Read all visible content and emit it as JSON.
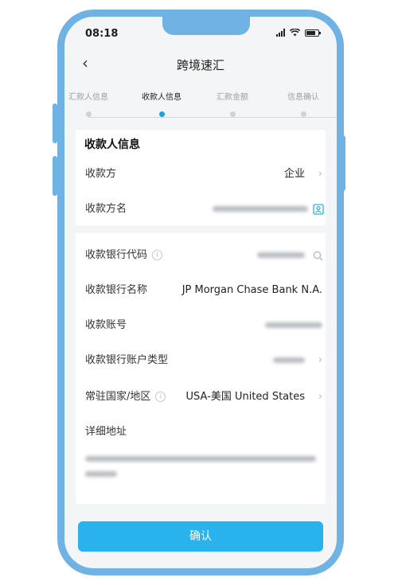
{
  "status_bar": {
    "time": "08:18"
  },
  "header": {
    "title": "跨境速汇"
  },
  "steps": [
    {
      "label": "汇款人信息",
      "active": false
    },
    {
      "label": "收款人信息",
      "active": true
    },
    {
      "label": "汇款金额",
      "active": false
    },
    {
      "label": "信息确认",
      "active": false
    }
  ],
  "section_title": "收款人信息",
  "payee": {
    "type_label": "收款方",
    "type_value": "企业",
    "name_label": "收款方名"
  },
  "bank": {
    "code_label": "收款银行代码",
    "name_label": "收款银行名称",
    "name_value": "JP Morgan Chase Bank N.A.",
    "account_label": "收款账号",
    "account_type_label": "收款银行账户类型",
    "country_label": "常驻国家/地区",
    "country_value": "USA-美国 United States",
    "address_label": "详细地址"
  },
  "confirm_label": "确认",
  "accent_color": "#29b2ec"
}
